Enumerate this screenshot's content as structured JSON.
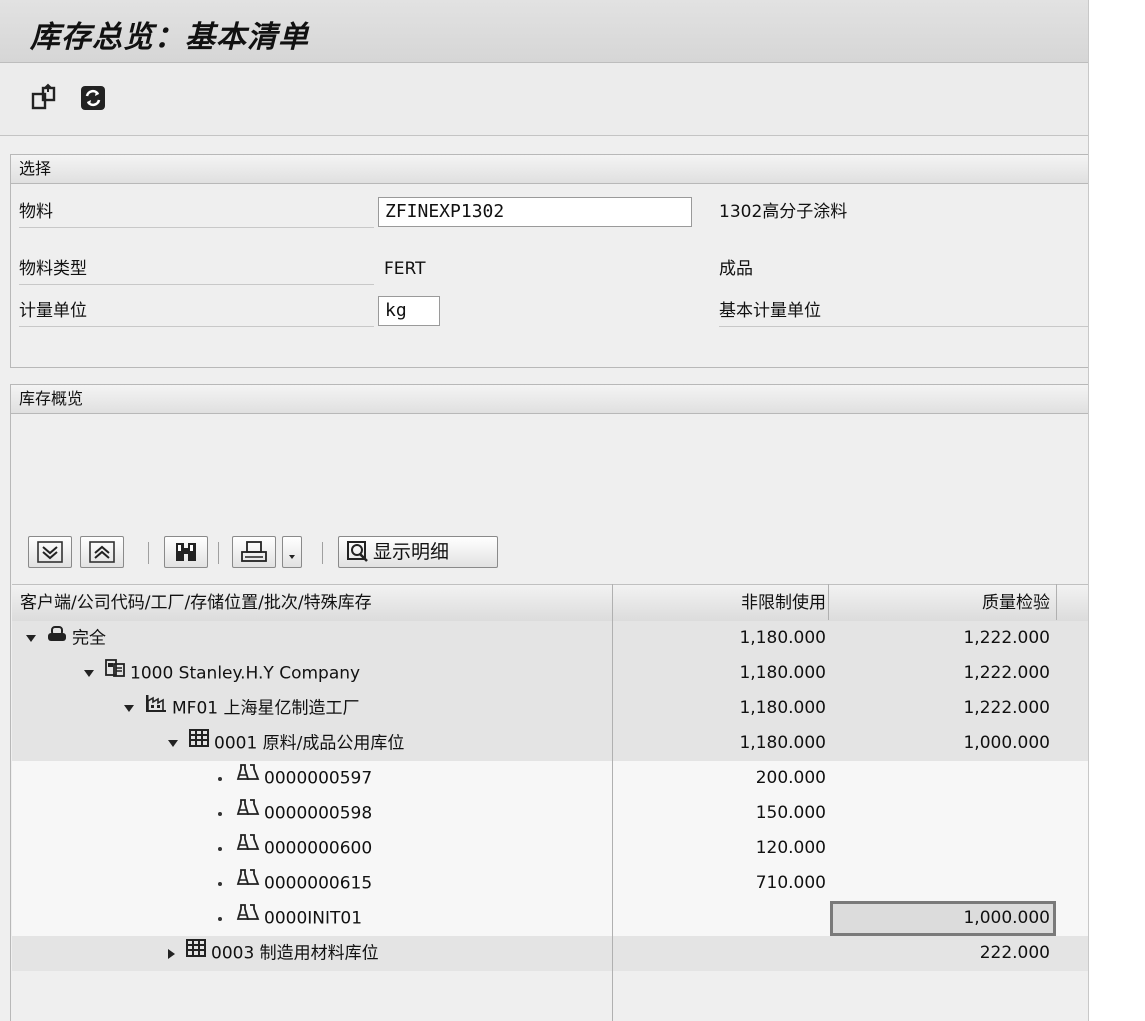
{
  "window": {
    "title": "库存总览：基本清单"
  },
  "toolbar": {
    "icons": [
      "export-icon",
      "refresh-icon"
    ]
  },
  "selection": {
    "header": "选择",
    "material_label": "物料",
    "material_value": "ZFINEXP1302",
    "material_desc": "1302高分子涂料",
    "material_type_label": "物料类型",
    "material_type_value": "FERT",
    "material_type_desc": "成品",
    "uom_label": "计量单位",
    "uom_value": "kg",
    "uom_desc": "基本计量单位"
  },
  "overview": {
    "header": "库存概览",
    "buttons": {
      "expand": "expand-all-icon",
      "collapse": "collapse-all-icon",
      "find": "find-icon",
      "print": "print-icon",
      "dropdown": "dropdown-icon",
      "details_label": "显示明细"
    },
    "columns": [
      "客户端/公司代码/工厂/存储位置/批次/特殊库存",
      "非限制使用",
      "质量检验"
    ],
    "rows": [
      {
        "toggle": "down",
        "icon": "client-icon",
        "text": "完全",
        "unrestricted": "1,180.000",
        "quality": "1,222.000"
      },
      {
        "toggle": "down",
        "icon": "company-icon",
        "text": "1000 Stanley.H.Y Company",
        "unrestricted": "1,180.000",
        "quality": "1,222.000"
      },
      {
        "toggle": "down",
        "icon": "plant-icon",
        "text": "MF01 上海星亿制造工厂",
        "unrestricted": "1,180.000",
        "quality": "1,222.000"
      },
      {
        "toggle": "down",
        "icon": "storage-location-icon",
        "text": "0001 原料/成品公用库位",
        "unrestricted": "1,180.000",
        "quality": "1,000.000"
      },
      {
        "toggle": "leaf",
        "icon": "batch-icon",
        "text": "0000000597",
        "unrestricted": "200.000",
        "quality": ""
      },
      {
        "toggle": "leaf",
        "icon": "batch-icon",
        "text": "0000000598",
        "unrestricted": "150.000",
        "quality": ""
      },
      {
        "toggle": "leaf",
        "icon": "batch-icon",
        "text": "0000000600",
        "unrestricted": "120.000",
        "quality": ""
      },
      {
        "toggle": "leaf",
        "icon": "batch-icon",
        "text": "0000000615",
        "unrestricted": "710.000",
        "quality": ""
      },
      {
        "toggle": "leaf",
        "icon": "batch-icon",
        "text": "0000INIT01",
        "unrestricted": "",
        "quality": "1,000.000"
      },
      {
        "toggle": "right",
        "icon": "storage-location-icon",
        "text": "0003 制造用材料库位",
        "unrestricted": "",
        "quality": "222.000"
      }
    ]
  }
}
